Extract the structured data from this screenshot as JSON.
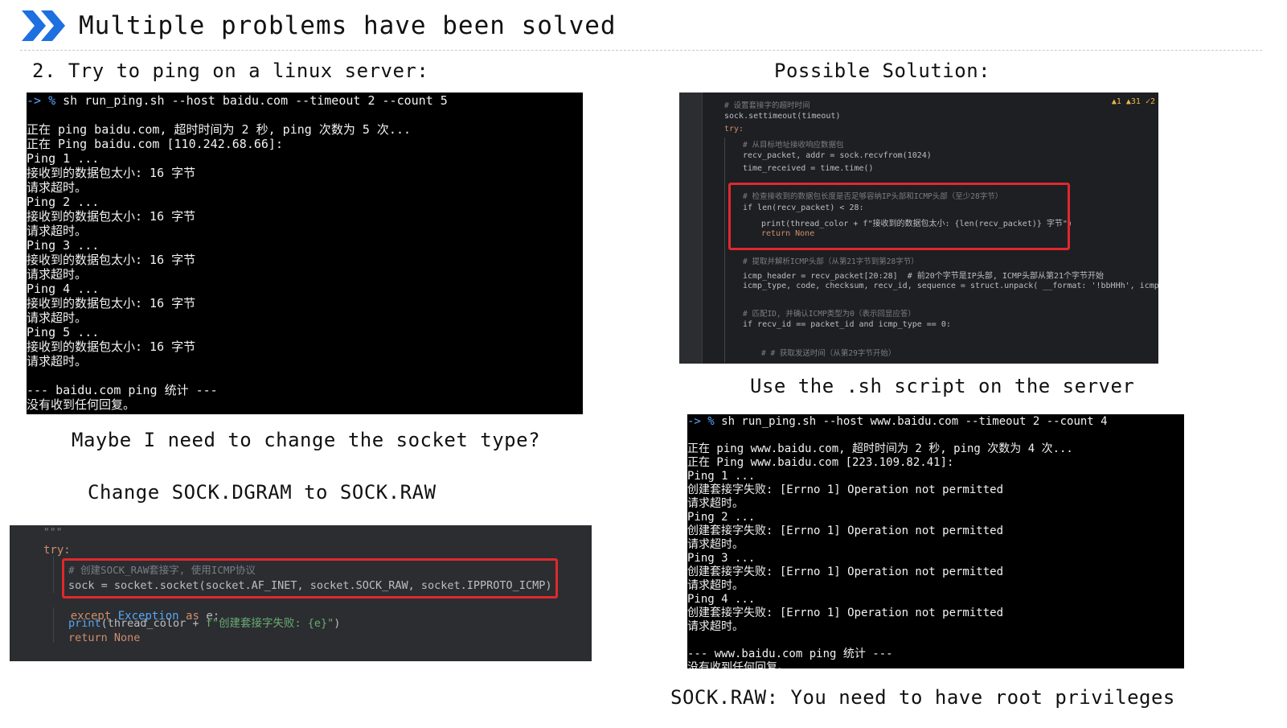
{
  "header": {
    "title": "Multiple problems have been solved"
  },
  "left": {
    "heading": "2. Try to ping on a linux server:",
    "terminal_lines": [
      "-> % sh run_ping.sh --host baidu.com --timeout 2 --count 5",
      "",
      "正在 ping baidu.com, 超时时间为 2 秒, ping 次数为 5 次...",
      "正在 Ping baidu.com [110.242.68.66]:",
      "Ping 1 ...",
      "接收到的数据包太小: 16 字节",
      "请求超时。",
      "Ping 2 ...",
      "接收到的数据包太小: 16 字节",
      "请求超时。",
      "Ping 3 ...",
      "接收到的数据包太小: 16 字节",
      "请求超时。",
      "Ping 4 ...",
      "接收到的数据包太小: 16 字节",
      "请求超时。",
      "Ping 5 ...",
      "接收到的数据包太小: 16 字节",
      "请求超时。",
      "",
      "--- baidu.com ping 统计 ---",
      "没有收到任何回复。"
    ],
    "question": "Maybe I need to change the socket type?",
    "change_note": "Change SOCK.DGRAM to SOCK.RAW",
    "code": {
      "docstring": "\"\"\"",
      "try": "try:",
      "comment": "# 创建SOCK_RAW套接字, 使用ICMP协议",
      "sock_line": "sock = socket.socket(socket.AF_INET, socket.SOCK_RAW, socket.IPPROTO_ICMP)",
      "except_kw": "except",
      "exception_name": "Exception",
      "as_kw": "as",
      "exc_var": "e:",
      "print_line_pre": "print",
      "print_args_1": "(thread_color + ",
      "print_fstring": "f\"创建套接字失败: {e}\"",
      "print_args_2": ")",
      "return_kw": "return",
      "none_kw": "None"
    }
  },
  "right": {
    "heading": "Possible Solution:",
    "ide": {
      "status": "▲1 ▲31 ✓2",
      "lines": [
        {
          "t": "# 设置套接字的超时时间",
          "c": "cm",
          "i": 0
        },
        {
          "t": "sock.settimeout(timeout)",
          "c": "",
          "i": 0
        },
        {
          "t": "try:",
          "c": "kw",
          "i": 0
        },
        {
          "t": "# 从目标地址接收响应数据包",
          "c": "cm",
          "i": 1
        },
        {
          "t": "recv_packet, addr = sock.recvfrom(1024)",
          "c": "",
          "i": 1
        },
        {
          "t": "time_received = time.time()",
          "c": "",
          "i": 1
        },
        {
          "t": "",
          "c": "",
          "i": 1
        },
        {
          "t": "# 检查接收到的数据包长度是否足够容纳IP头部和ICMP头部（至少28字节）",
          "c": "cm",
          "i": 1
        },
        {
          "t": "if len(recv_packet) < 28:",
          "c": "",
          "i": 1
        },
        {
          "t": "print(thread_color + f\"接收到的数据包太小: {len(recv_packet)} 字节\")",
          "c": "",
          "i": 2
        },
        {
          "t": "return None",
          "c": "kw",
          "i": 2
        },
        {
          "t": "",
          "c": "",
          "i": 1
        },
        {
          "t": "# 提取并解析ICMP头部（从第21字节到第28字节）",
          "c": "cm",
          "i": 1
        },
        {
          "t": "icmp_header = recv_packet[20:28]  # 前20个字节是IP头部, ICMP头部从第21个字节开始",
          "c": "",
          "i": 1
        },
        {
          "t": "icmp_type, code, checksum, recv_id, sequence = struct.unpack( __format: '!bbHHh', icmp_header)",
          "c": "",
          "i": 1
        },
        {
          "t": "",
          "c": "",
          "i": 1
        },
        {
          "t": "# 匹配ID, 并确认ICMP类型为0（表示回显应答）",
          "c": "cm",
          "i": 1
        },
        {
          "t": "if recv_id == packet_id and icmp_type == 0:",
          "c": "",
          "i": 1
        },
        {
          "t": "",
          "c": "",
          "i": 1
        },
        {
          "t": "# # 获取发送时间（从第29字节开始）",
          "c": "cm",
          "i": 2
        }
      ]
    },
    "caption": "Use the .sh script on the server",
    "terminal_lines": [
      "-> % sh run_ping.sh --host www.baidu.com --timeout 2 --count 4",
      "",
      "正在 ping www.baidu.com, 超时时间为 2 秒, ping 次数为 4 次...",
      "正在 Ping www.baidu.com [223.109.82.41]:",
      "Ping 1 ...",
      "创建套接字失败: [Errno 1] Operation not permitted",
      "请求超时。",
      "Ping 2 ...",
      "创建套接字失败: [Errno 1] Operation not permitted",
      "请求超时。",
      "Ping 3 ...",
      "创建套接字失败: [Errno 1] Operation not permitted",
      "请求超时。",
      "Ping 4 ...",
      "创建套接字失败: [Errno 1] Operation not permitted",
      "请求超时。",
      "",
      "--- www.baidu.com ping 统计 ---",
      "没有收到任何回复。"
    ],
    "footer": "SOCK.RAW: You need to have root privileges"
  },
  "colors": {
    "accent": "#1e6fe0",
    "highlight_box": "#e0282e",
    "terminal_bg": "#000000",
    "ide_bg": "#2b2d30"
  }
}
